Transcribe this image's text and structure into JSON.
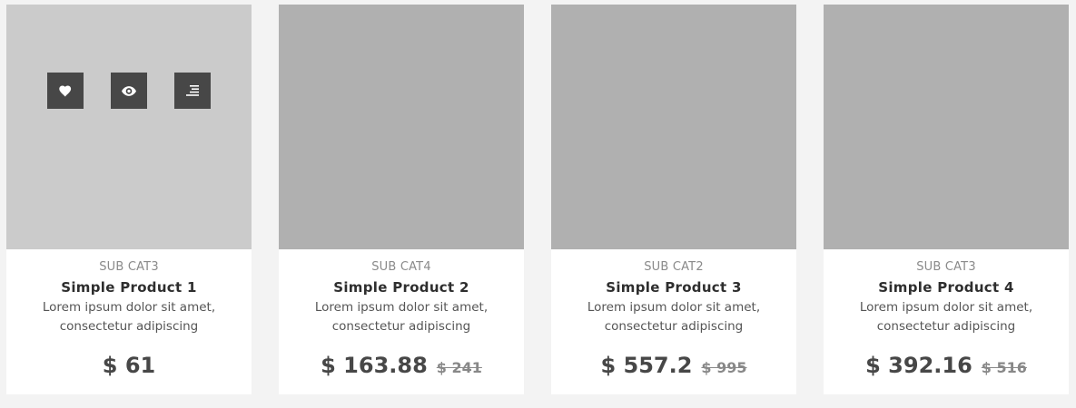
{
  "products": [
    {
      "category": "SUB CAT3",
      "title": "Simple Product 1",
      "desc_line1": "Lorem ipsum dolor sit amet,",
      "desc_line2": "consectetur adipiscing",
      "price": "$ 61",
      "old_price": ""
    },
    {
      "category": "SUB CAT4",
      "title": "Simple Product 2",
      "desc_line1": "Lorem ipsum dolor sit amet,",
      "desc_line2": "consectetur adipiscing",
      "price": "$ 163.88",
      "old_price": "$ 241"
    },
    {
      "category": "SUB CAT2",
      "title": "Simple Product 3",
      "desc_line1": "Lorem ipsum dolor sit amet,",
      "desc_line2": "consectetur adipiscing",
      "price": "$ 557.2",
      "old_price": "$ 995"
    },
    {
      "category": "SUB CAT3",
      "title": "Simple Product 4",
      "desc_line1": "Lorem ipsum dolor sit amet,",
      "desc_line2": "consectetur adipiscing",
      "price": "$ 392.16",
      "old_price": "$ 516"
    }
  ],
  "hover_actions": [
    "heart-icon",
    "eye-icon",
    "menu-icon"
  ],
  "colors": {
    "background": "#f3f3f3",
    "image_placeholder": "#b0b0b0",
    "image_hover": "#cbcbcb",
    "action_button": "#474747"
  }
}
